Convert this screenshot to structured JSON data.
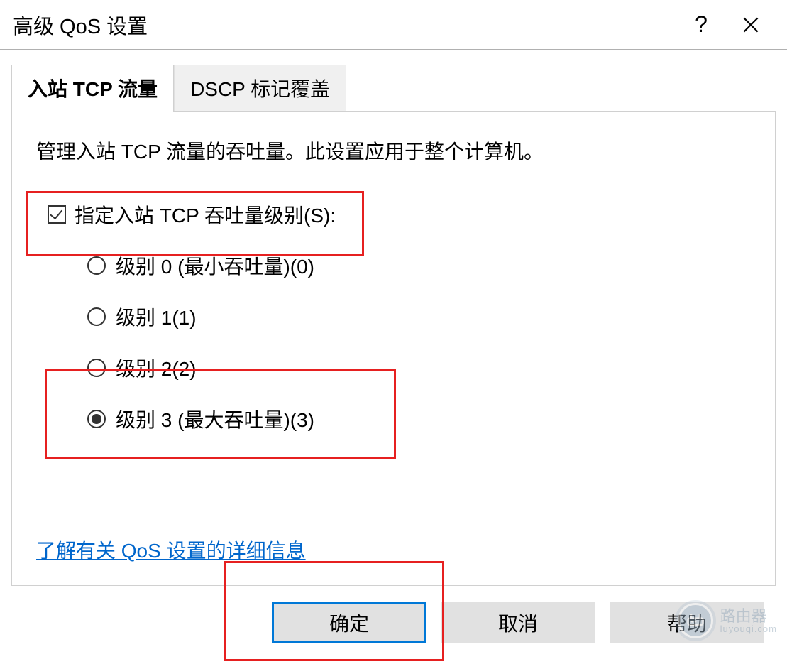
{
  "window": {
    "title": "高级 QoS 设置"
  },
  "tabs": [
    {
      "label": "入站 TCP 流量",
      "active": true
    },
    {
      "label": "DSCP 标记覆盖",
      "active": false
    }
  ],
  "panel": {
    "description": "管理入站 TCP 流量的吞吐量。此设置应用于整个计算机。",
    "checkbox": {
      "label": "指定入站 TCP 吞吐量级别(S):",
      "checked": true
    },
    "radios": [
      {
        "label": "级别 0 (最小吞吐量)(0)",
        "selected": false
      },
      {
        "label": "级别 1(1)",
        "selected": false
      },
      {
        "label": "级别 2(2)",
        "selected": false
      },
      {
        "label": "级别 3 (最大吞吐量)(3)",
        "selected": true
      }
    ],
    "link": "了解有关 QoS 设置的详细信息"
  },
  "buttons": {
    "ok": "确定",
    "cancel": "取消",
    "help": "帮助"
  },
  "watermark": {
    "text": "路由器",
    "sub": "luyouqi.com"
  }
}
